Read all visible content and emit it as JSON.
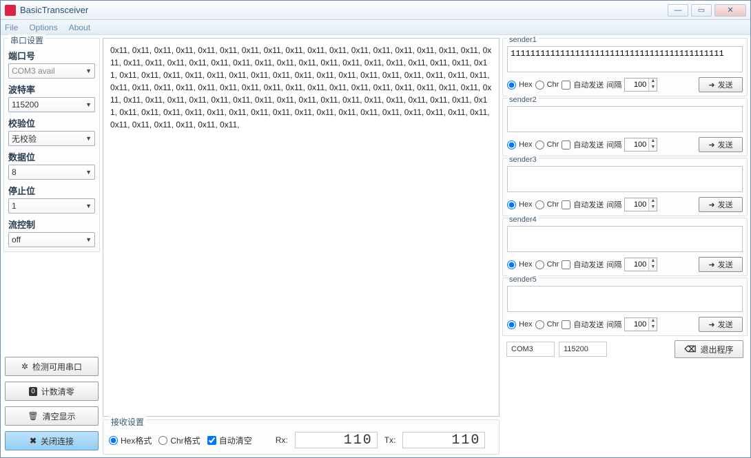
{
  "window": {
    "title": "BasicTransceiver"
  },
  "menu": {
    "file": "File",
    "options": "Options",
    "about": "About"
  },
  "sidebar": {
    "group_title": "串口设置",
    "port_label": "端口号",
    "port_value": "COM3  avail",
    "baud_label": "波特率",
    "baud_value": "115200",
    "check_label": "校验位",
    "check_value": "无校验",
    "data_label": "数据位",
    "data_value": "8",
    "stop_label": "停止位",
    "stop_value": "1",
    "flow_label": "流控制",
    "flow_value": "off",
    "btn_detect": "检测可用串口",
    "btn_counter": "计数清零",
    "btn_clear": "清空显示",
    "btn_close": "关闭连接"
  },
  "rx": {
    "content": "0x11, 0x11, 0x11, 0x11, 0x11, 0x11, 0x11, 0x11, 0x11, 0x11, 0x11, 0x11, 0x11, 0x11, 0x11, 0x11, 0x11, 0x11, 0x11, 0x11, 0x11, 0x11, 0x11, 0x11, 0x11, 0x11, 0x11, 0x11, 0x11, 0x11, 0x11, 0x11, 0x11, 0x11, 0x11, 0x11, 0x11, 0x11, 0x11, 0x11, 0x11, 0x11, 0x11, 0x11, 0x11, 0x11, 0x11, 0x11, 0x11, 0x11, 0x11, 0x11, 0x11, 0x11, 0x11, 0x11, 0x11, 0x11, 0x11, 0x11, 0x11, 0x11, 0x11, 0x11, 0x11, 0x11, 0x11, 0x11, 0x11, 0x11, 0x11, 0x11, 0x11, 0x11, 0x11, 0x11, 0x11, 0x11, 0x11, 0x11, 0x11, 0x11, 0x11, 0x11, 0x11, 0x11, 0x11, 0x11, 0x11, 0x11, 0x11, 0x11, 0x11, 0x11, 0x11, 0x11, 0x11, 0x11, 0x11, 0x11, 0x11, 0x11, 0x11, 0x11, 0x11, 0x11, 0x11, 0x11, 0x11, 0x11,",
    "settings_title": "接收设置",
    "hex_fmt": "Hex格式",
    "chr_fmt": "Chr格式",
    "auto_clear": "自动清空",
    "rx_label": "Rx:",
    "rx_count": "110",
    "tx_label": "Tx:",
    "tx_count": "110"
  },
  "senders": [
    {
      "name": "sender1",
      "value": "1111111111111111111111111111111111111111111",
      "hex": "Hex",
      "chr": "Chr",
      "auto": "自动发送",
      "interval_label": "间隔",
      "interval": "100",
      "send": "发送"
    },
    {
      "name": "sender2",
      "value": "",
      "hex": "Hex",
      "chr": "Chr",
      "auto": "自动发送",
      "interval_label": "间隔",
      "interval": "100",
      "send": "发送"
    },
    {
      "name": "sender3",
      "value": "",
      "hex": "Hex",
      "chr": "Chr",
      "auto": "自动发送",
      "interval_label": "间隔",
      "interval": "100",
      "send": "发送"
    },
    {
      "name": "sender4",
      "value": "",
      "hex": "Hex",
      "chr": "Chr",
      "auto": "自动发送",
      "interval_label": "间隔",
      "interval": "100",
      "send": "发送"
    },
    {
      "name": "sender5",
      "value": "",
      "hex": "Hex",
      "chr": "Chr",
      "auto": "自动发送",
      "interval_label": "间隔",
      "interval": "100",
      "send": "发送"
    }
  ],
  "footer": {
    "port": "COM3",
    "baud": "115200",
    "exit": "退出程序"
  }
}
